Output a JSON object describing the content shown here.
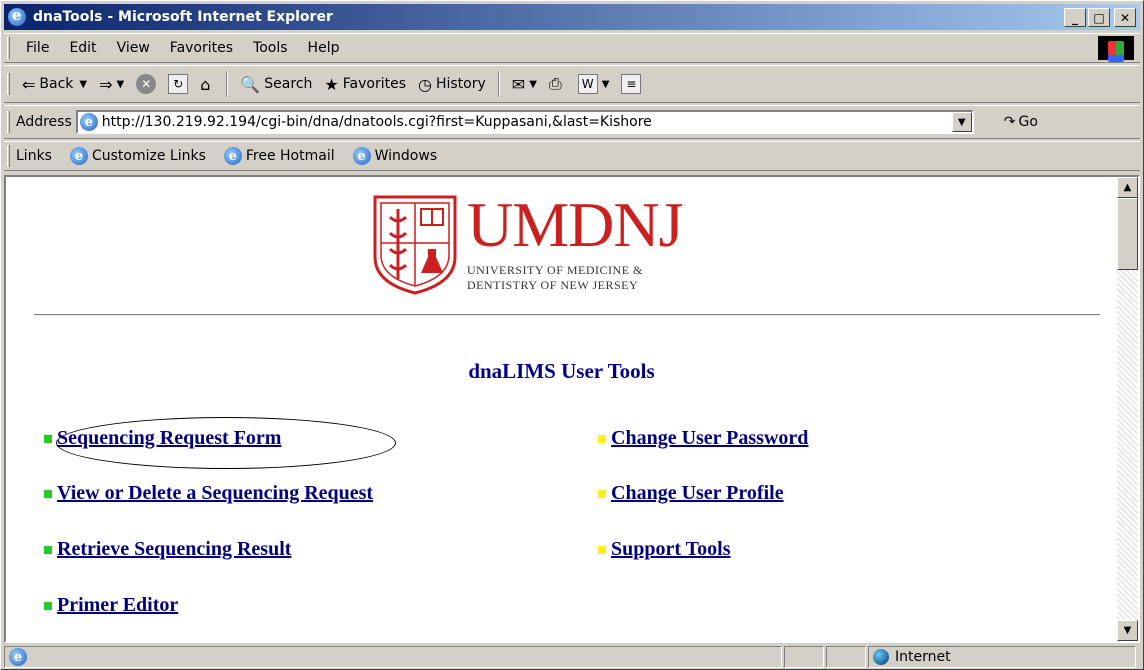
{
  "window": {
    "title": "dnaTools - Microsoft Internet Explorer"
  },
  "menu": [
    "File",
    "Edit",
    "View",
    "Favorites",
    "Tools",
    "Help"
  ],
  "toolbar": {
    "back": "Back",
    "search": "Search",
    "favorites": "Favorites",
    "history": "History"
  },
  "address": {
    "label": "Address",
    "url": "http://130.219.92.194/cgi-bin/dna/dnatools.cgi?first=Kuppasani,&last=Kishore",
    "go": "Go"
  },
  "links": {
    "label": "Links",
    "items": [
      "Customize Links",
      "Free Hotmail",
      "Windows"
    ]
  },
  "logo": {
    "name": "UMDNJ",
    "line1": "UNIVERSITY OF MEDICINE &",
    "line2": "DENTISTRY OF NEW JERSEY"
  },
  "page": {
    "heading": "dnaLIMS User Tools",
    "left_tools": [
      "Sequencing Request Form",
      "View or Delete a Sequencing Request",
      "Retrieve Sequencing Result",
      "Primer Editor"
    ],
    "right_tools": [
      "Change User Password",
      "Change User Profile",
      "Support Tools"
    ]
  },
  "status": {
    "zone": "Internet"
  }
}
